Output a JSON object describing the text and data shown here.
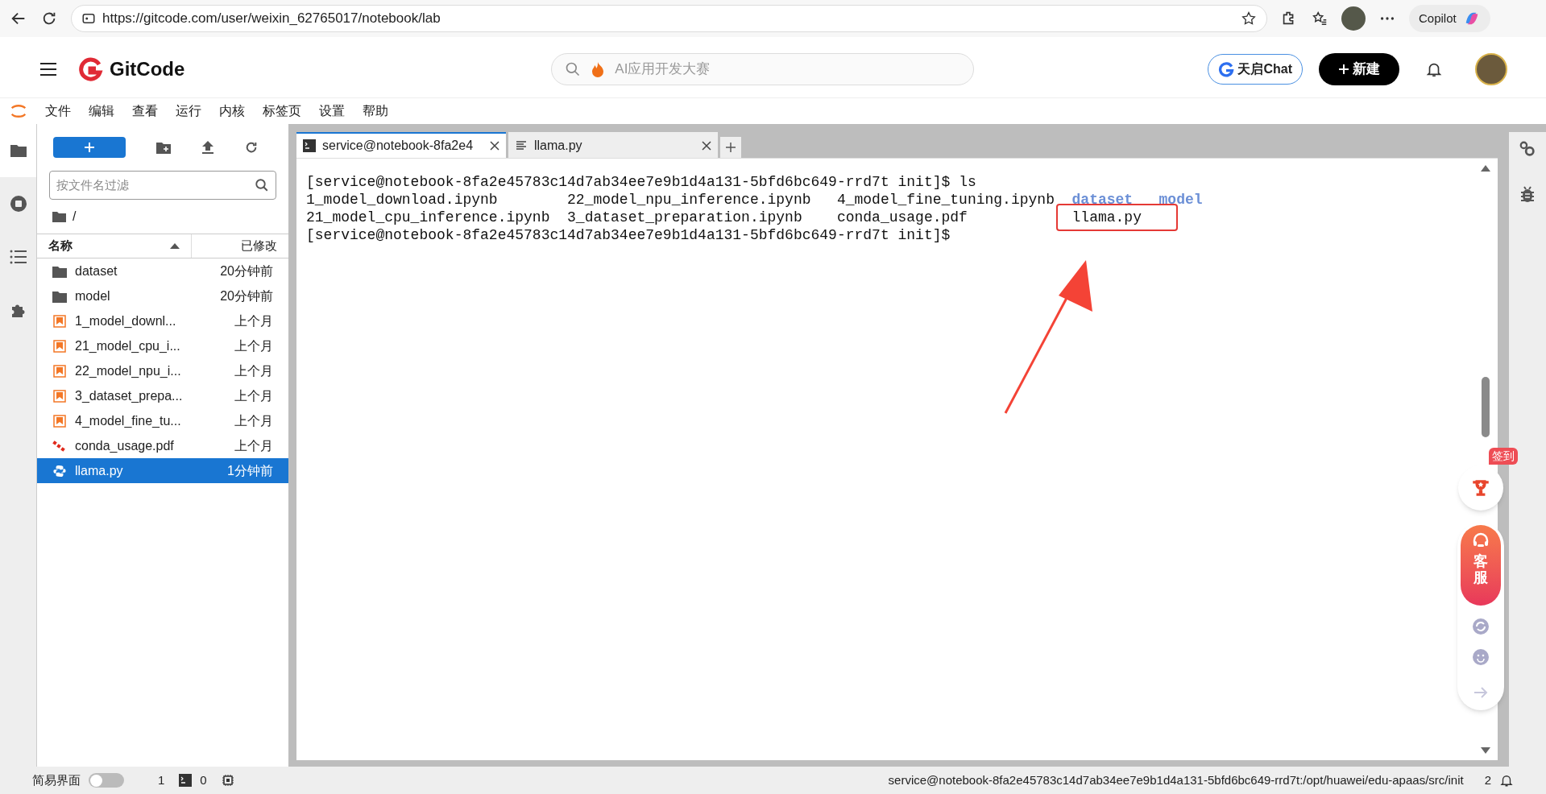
{
  "browser": {
    "url": "https://gitcode.com/user/weixin_62765017/notebook/lab",
    "copilot": "Copilot"
  },
  "header": {
    "logo": "GitCode",
    "search_placeholder": "AI应用开发大赛",
    "chat_button": "天启Chat",
    "new_button": "新建"
  },
  "menu": [
    "文件",
    "编辑",
    "查看",
    "运行",
    "内核",
    "标签页",
    "设置",
    "帮助"
  ],
  "side_tabs": [
    {
      "kind": "folder",
      "selected": true
    },
    {
      "kind": "stop",
      "selected": false
    },
    {
      "kind": "list",
      "selected": false
    },
    {
      "kind": "puzzle",
      "selected": false
    }
  ],
  "file_browser": {
    "filter_placeholder": "按文件名过滤",
    "path": "/",
    "columns": [
      "名称",
      "已修改"
    ],
    "files": [
      {
        "name": "dataset",
        "modified": "20分钟前",
        "kind": "folder",
        "selected": false
      },
      {
        "name": "model",
        "modified": "20分钟前",
        "kind": "folder",
        "selected": false
      },
      {
        "name": "1_model_downl...",
        "modified": "上个月",
        "kind": "notebook",
        "selected": false
      },
      {
        "name": "21_model_cpu_i...",
        "modified": "上个月",
        "kind": "notebook",
        "selected": false
      },
      {
        "name": "22_model_npu_i...",
        "modified": "上个月",
        "kind": "notebook",
        "selected": false
      },
      {
        "name": "3_dataset_prepa...",
        "modified": "上个月",
        "kind": "notebook",
        "selected": false
      },
      {
        "name": "4_model_fine_tu...",
        "modified": "上个月",
        "kind": "notebook",
        "selected": false
      },
      {
        "name": "conda_usage.pdf",
        "modified": "上个月",
        "kind": "pdf",
        "selected": false
      },
      {
        "name": "llama.py",
        "modified": "1分钟前",
        "kind": "python",
        "selected": true
      }
    ]
  },
  "tabs": [
    {
      "label": "service@notebook-8fa2e4",
      "kind": "terminal",
      "selected": true
    },
    {
      "label": "llama.py",
      "kind": "text",
      "selected": false
    }
  ],
  "terminal": [
    {
      "kind": "prompt",
      "text": "[service@notebook-8fa2e45783c14d7ab34ee7e9b1d4a131-5bfd6bc649-rrd7t init]$ ls"
    },
    {
      "kind": "listing",
      "cells": [
        {
          "text": "1_model_download.ipynb",
          "kind": "file"
        },
        {
          "text": "22_model_npu_inference.ipynb",
          "kind": "file"
        },
        {
          "text": "4_model_fine_tuning.ipynb",
          "kind": "file"
        },
        {
          "text": "dataset",
          "kind": "dir"
        },
        {
          "text": "model",
          "kind": "dir"
        }
      ]
    },
    {
      "kind": "listing",
      "cells": [
        {
          "text": "21_model_cpu_inference.ipynb",
          "kind": "file"
        },
        {
          "text": "3_dataset_preparation.ipynb",
          "kind": "file"
        },
        {
          "text": "conda_usage.pdf",
          "kind": "file"
        },
        {
          "text": "llama.py",
          "kind": "file",
          "highlighted": true
        }
      ]
    },
    {
      "kind": "prompt",
      "text": "[service@notebook-8fa2e45783c14d7ab34ee7e9b1d4a131-5bfd6bc649-rrd7t init]$"
    }
  ],
  "floating": {
    "checkin": "签到",
    "service": "客服"
  },
  "status_bar": {
    "simple_mode": "简易界面",
    "simple_mode_on": false,
    "kernels": "1",
    "terminals": "0",
    "path": "service@notebook-8fa2e45783c14d7ab34ee7e9b1d4a131-5bfd6bc649-rrd7t:/opt/huawei/edu-apaas/src/init",
    "count": "2"
  }
}
